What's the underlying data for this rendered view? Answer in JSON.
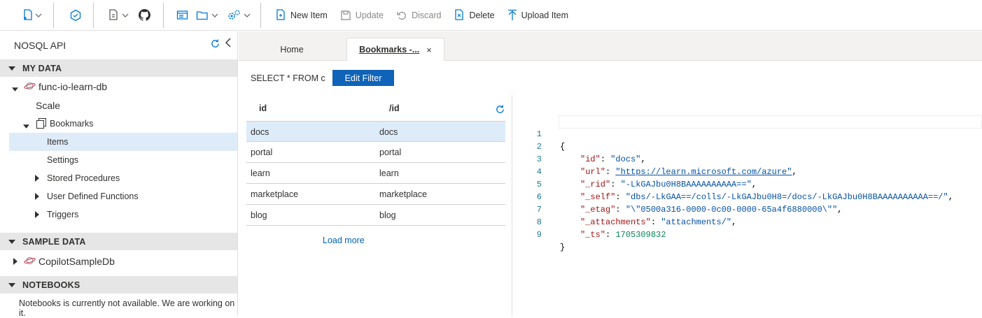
{
  "toolbar": {
    "buttons": {
      "new_item": "New Item",
      "update": "Update",
      "discard": "Discard",
      "delete": "Delete",
      "upload_item": "Upload Item"
    }
  },
  "left_panel": {
    "title": "NOSQL API",
    "sections": {
      "my_data": "MY DATA",
      "sample_data": "SAMPLE DATA",
      "notebooks": "NOTEBOOKS"
    },
    "tree": {
      "database": "func-io-learn-db",
      "scale": "Scale",
      "container": "Bookmarks",
      "items": "Items",
      "settings": "Settings",
      "stored_procedures": "Stored Procedures",
      "user_defined_functions": "User Defined Functions",
      "triggers": "Triggers",
      "sample_db": "CopilotSampleDb"
    },
    "notebooks_message": "Notebooks is currently not available. We are working on it."
  },
  "tabs": {
    "home": "Home",
    "active": "Bookmarks -...",
    "close": "×"
  },
  "query": {
    "text": "SELECT * FROM c",
    "edit_filter": "Edit Filter"
  },
  "results": {
    "columns": [
      "id",
      "/id"
    ],
    "rows": [
      [
        "docs",
        "docs"
      ],
      [
        "portal",
        "portal"
      ],
      [
        "learn",
        "learn"
      ],
      [
        "marketplace",
        "marketplace"
      ],
      [
        "blog",
        "blog"
      ]
    ],
    "load_more": "Load more"
  },
  "document": {
    "line_numbers": [
      "1",
      "2",
      "3",
      "4",
      "5",
      "6",
      "7",
      "8",
      "9"
    ],
    "open_brace": "{",
    "close_brace": "}",
    "fields": [
      {
        "key": "\"id\"",
        "value": "\"docs\"",
        "kind": "string",
        "comma": ","
      },
      {
        "key": "\"url\"",
        "value": "\"https://learn.microsoft.com/azure\"",
        "kind": "url",
        "comma": ","
      },
      {
        "key": "\"_rid\"",
        "value": "\"-LkGAJbu0H8BAAAAAAAAAA==\"",
        "kind": "string",
        "comma": ","
      },
      {
        "key": "\"_self\"",
        "value": "\"dbs/-LkGAA==/colls/-LkGAJbu0H8=/docs/-LkGAJbu0H8BAAAAAAAAAA==/\"",
        "kind": "string",
        "comma": ","
      },
      {
        "key": "\"_etag\"",
        "value": "\"\\\"0500a316-0000-0c00-0000-65a4f6880000\\\"\"",
        "kind": "string",
        "comma": ","
      },
      {
        "key": "\"_attachments\"",
        "value": "\"attachments/\"",
        "kind": "string",
        "comma": ","
      },
      {
        "key": "\"_ts\"",
        "value": "1705309832",
        "kind": "number",
        "comma": ""
      }
    ]
  },
  "colors": {
    "accent": "#0078d4",
    "selected_row": "#deecf9",
    "section_bg": "#e6e6e6",
    "json_key": "#a31515",
    "json_string": "#0451a5",
    "json_number": "#098658"
  }
}
